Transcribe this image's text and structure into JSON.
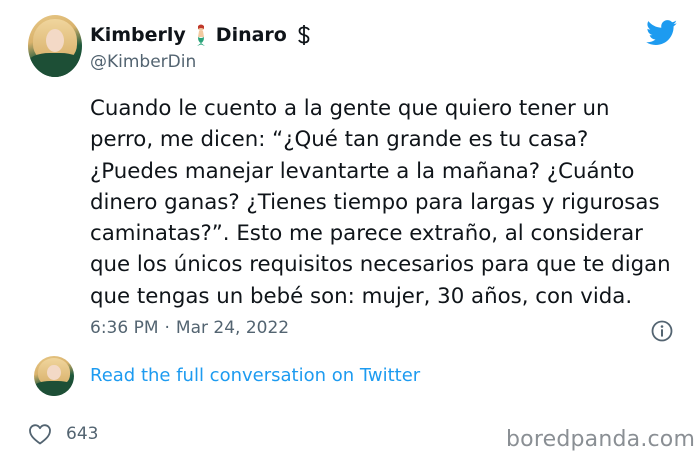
{
  "author": {
    "name_first": "Kimberly",
    "name_second": "Dinaro",
    "handle": "@KimberDin",
    "name_icons": [
      "mermaid-icon",
      "heavy-dollar-sign-icon"
    ]
  },
  "tweet": {
    "text": "Cuando le cuento a la gente que quiero tener un\nperro, me dicen: “¿Qué tan grande es tu casa?\n¿Puedes manejar levantarte a la mañana? ¿Cuánto\ndinero ganas? ¿Tienes tiempo para largas y rigurosas\ncaminatas?”. Esto me parece extraño, al considerar\nque los únicos requisitos necesarios para que te digan\nque tengas un bebé son: mujer, 30 años, con vida.",
    "time": "6:36 PM",
    "separator": "·",
    "date": "Mar 24, 2022"
  },
  "conversation_link": "Read the full conversation on Twitter",
  "likes": {
    "count": "643",
    "icon": "heart-outline-icon"
  },
  "watermark": "boredpanda.com",
  "colors": {
    "text": "#0f1419",
    "muted": "#536471",
    "twitter_blue": "#1d9bf0",
    "watermark": "#8a8f94"
  }
}
